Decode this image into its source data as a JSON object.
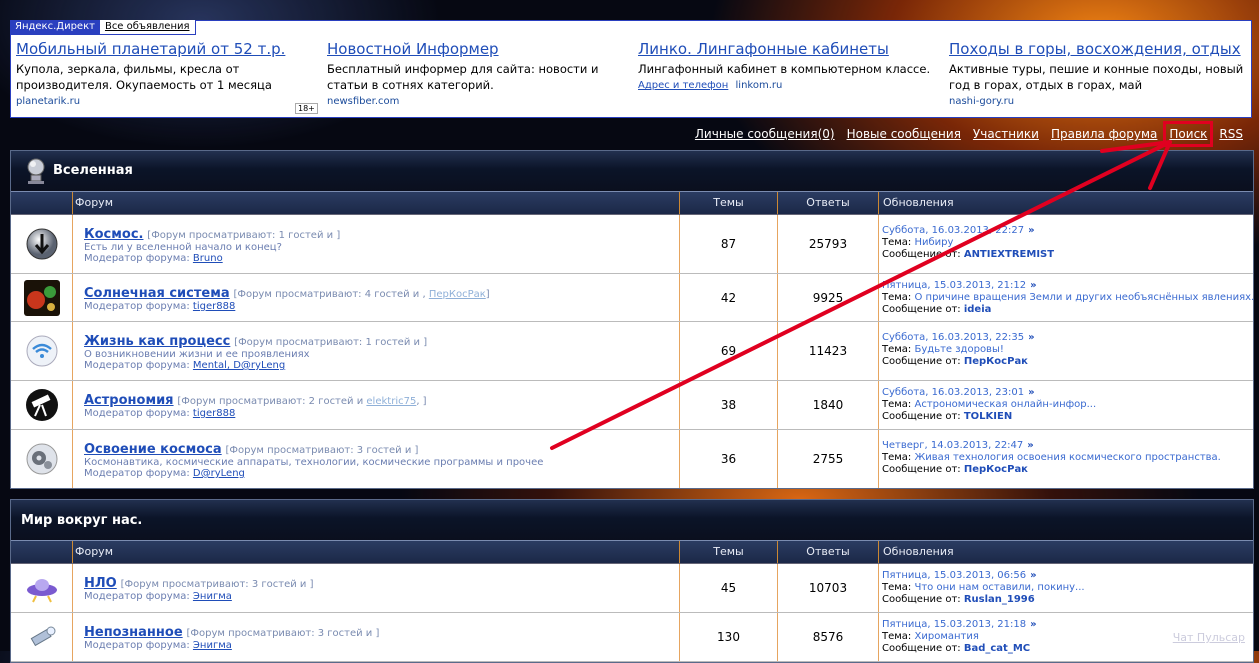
{
  "ad": {
    "tab_yandex": "Яндекс.Директ",
    "tab_all": "Все объявления",
    "age": "18+",
    "items": [
      {
        "title": "Мобильный планетарий от 52 т.р.",
        "text": "Купола, зеркала, фильмы, кресла от производителя. Окупаемость от 1 месяца",
        "url": "planetarik.ru",
        "link": ""
      },
      {
        "title": "Новостной Информер",
        "text": "Бесплатный информер для сайта: новости и статьи в сотнях категорий.",
        "url": "newsfiber.com",
        "link": ""
      },
      {
        "title": "Линко. Лингафонные кабинеты",
        "text": "Лингафонный кабинет в компьютерном классе.",
        "url": "linkom.ru",
        "link": "Адрес и телефон"
      },
      {
        "title": "Походы в горы, восхождения, отдых",
        "text": "Активные туры, пешие и конные походы, новый год в горах, отдых в горах, май",
        "url": "nashi-gory.ru",
        "link": ""
      }
    ]
  },
  "nav": {
    "pm": "Личные сообщения(0)",
    "new": "Новые сообщения",
    "members": "Участники",
    "rules": "Правила форума",
    "search": "Поиск",
    "rss": "RSS"
  },
  "columns": {
    "forum": "Форум",
    "topics": "Темы",
    "posts": "Ответы",
    "updates": "Обновления"
  },
  "labels": {
    "topic": "Тема:",
    "msg_from": "Сообщение от:",
    "moderator": "Модератор форума:"
  },
  "sections": [
    {
      "title": "Вселенная",
      "forums": [
        {
          "name": "Космос.",
          "viewing": "[Форум просматривают: 1 гостей и ]",
          "viewer": "",
          "desc": "Есть ли у вселенной начало и конец?",
          "moderators": "Bruno",
          "topics": "87",
          "posts": "25793",
          "date": "Суббота, 16.03.2013, 22:27",
          "topic": "Нибиру",
          "user": "ANTIEXTREMIST",
          "icon": "arrow-globe-icon"
        },
        {
          "name": "Солнечная система",
          "viewing": "[Форум просматривают: 4 гостей и ,",
          "viewer": "ПерКосРак",
          "desc": "",
          "moderators": "tiger888",
          "topics": "42",
          "posts": "9925",
          "date": "Пятница, 15.03.2013, 21:12",
          "topic": "О причине вращения Земли и других необъяснённых явлениях.",
          "user": "ideia",
          "icon": "planets-icon"
        },
        {
          "name": "Жизнь как процесс",
          "viewing": "[Форум просматривают: 1 гостей и ]",
          "viewer": "",
          "desc": "О возникновении жизни и ее проявлениях",
          "moderators": "Mental, D@ryLeng",
          "topics": "69",
          "posts": "11423",
          "date": "Суббота, 16.03.2013, 22:35",
          "topic": "Будьте здоровы!",
          "user": "ПерКосРак",
          "icon": "wifi-icon"
        },
        {
          "name": "Астрономия",
          "viewing": "[Форум просматривают: 2 гостей и",
          "viewer": "elektric75",
          "desc": "",
          "moderators": "tiger888",
          "topics": "38",
          "posts": "1840",
          "date": "Суббота, 16.03.2013, 23:01",
          "topic": "Астрономическая онлайн-инфор...",
          "user": "TOLKIEN",
          "icon": "telescope-icon"
        },
        {
          "name": "Освоение космоса",
          "viewing": "[Форум просматривают: 3 гостей и ]",
          "viewer": "",
          "desc": "Космонавтика, космические аппараты, технологии, космические программы и прочее",
          "moderators": "D@ryLeng",
          "topics": "36",
          "posts": "2755",
          "date": "Четверг, 14.03.2013, 22:47",
          "topic": "Живая технология освоения космического пространства.",
          "user": "ПерКосРак",
          "icon": "gears-icon"
        }
      ]
    },
    {
      "title": "Мир вокруг нас.",
      "forums": [
        {
          "name": "НЛО",
          "viewing": "[Форум просматривают: 3 гостей и ]",
          "viewer": "",
          "desc": "",
          "moderators": "Энигма",
          "topics": "45",
          "posts": "10703",
          "date": "Пятница, 15.03.2013, 06:56",
          "topic": "Что они нам оставили, покину...",
          "user": "Ruslan_1996",
          "icon": "ufo-icon"
        },
        {
          "name": "Непознанное",
          "viewing": "[Форум просматривают: 3 гостей и ]",
          "viewer": "",
          "desc": "",
          "moderators": "Энигма",
          "topics": "130",
          "posts": "8576",
          "date": "Пятница, 15.03.2013, 21:18",
          "topic": "Хиромантия",
          "user": "Bad_cat_MC",
          "icon": "flashlight-icon"
        }
      ]
    }
  ],
  "chat": "Чат Пульсар",
  "colors": {
    "accent_link": "#1f4db8",
    "annotation": "#e00020"
  }
}
